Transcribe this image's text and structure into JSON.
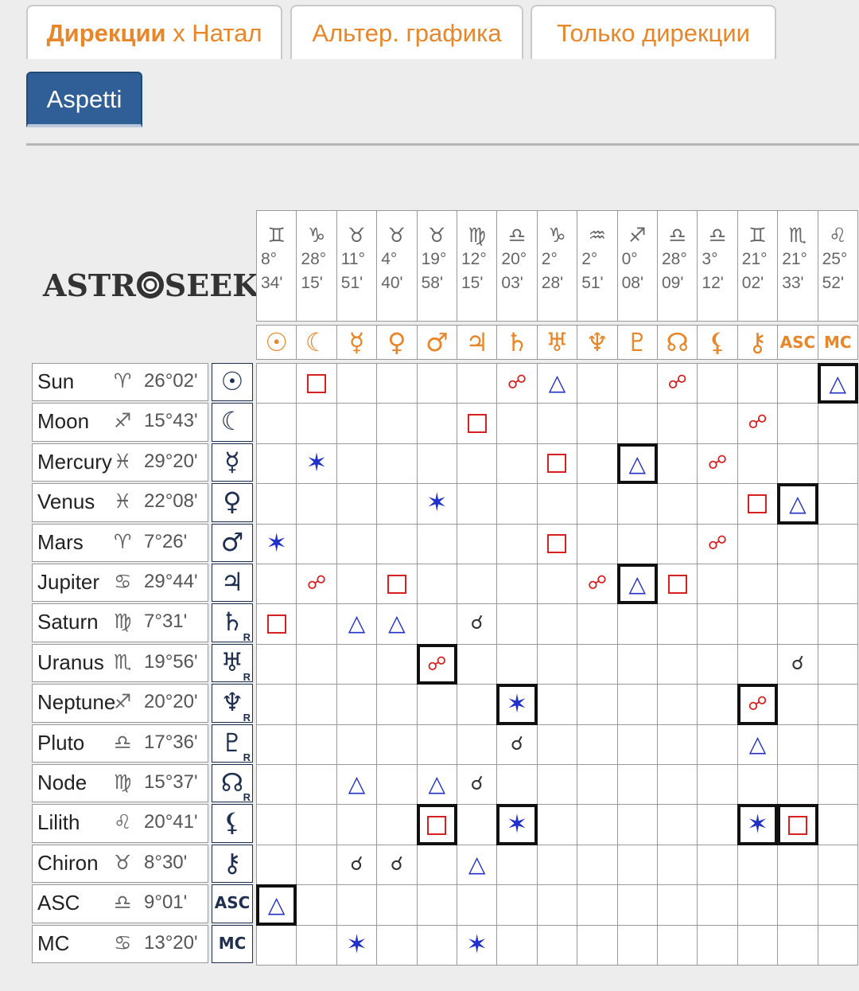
{
  "tabs": [
    {
      "label_bold": "Дирекции",
      "label_rest": " x Натал",
      "active": true
    },
    {
      "label": "Альтер. графика"
    },
    {
      "label": "Только дирекции"
    }
  ],
  "subtab": {
    "label": "Aspetti"
  },
  "logo": {
    "left": "ASTR",
    "right": "SEEK"
  },
  "columns": [
    {
      "sign": "♊",
      "deg": "8°",
      "min": "34'",
      "planet": "☉"
    },
    {
      "sign": "♑",
      "deg": "28°",
      "min": "15'",
      "planet": "☾"
    },
    {
      "sign": "♉",
      "deg": "11°",
      "min": "51'",
      "planet": "☿"
    },
    {
      "sign": "♉",
      "deg": "4°",
      "min": "40'",
      "planet": "♀"
    },
    {
      "sign": "♉",
      "deg": "19°",
      "min": "58'",
      "planet": "♂"
    },
    {
      "sign": "♍",
      "deg": "12°",
      "min": "15'",
      "planet": "♃"
    },
    {
      "sign": "♎",
      "deg": "20°",
      "min": "03'",
      "planet": "♄"
    },
    {
      "sign": "♑",
      "deg": "2°",
      "min": "28'",
      "planet": "♅"
    },
    {
      "sign": "♒",
      "deg": "2°",
      "min": "51'",
      "planet": "♆"
    },
    {
      "sign": "♐",
      "deg": "0°",
      "min": "08'",
      "planet": "♇"
    },
    {
      "sign": "♎",
      "deg": "28°",
      "min": "09'",
      "planet": "☊"
    },
    {
      "sign": "♎",
      "deg": "3°",
      "min": "12'",
      "planet": "⚸"
    },
    {
      "sign": "♊",
      "deg": "21°",
      "min": "02'",
      "planet": "⚷"
    },
    {
      "sign": "♏",
      "deg": "21°",
      "min": "33'",
      "planet": "ASC"
    },
    {
      "sign": "♌",
      "deg": "25°",
      "min": "52'",
      "planet": "MC"
    }
  ],
  "rows": [
    {
      "name": "Sun",
      "sign": "♈",
      "pos": "26°02'",
      "glyph": "☉",
      "retro": ""
    },
    {
      "name": "Moon",
      "sign": "♐",
      "pos": "15°43'",
      "glyph": "☾",
      "retro": ""
    },
    {
      "name": "Mercury",
      "sign": "♓",
      "pos": "29°20'",
      "glyph": "☿",
      "retro": ""
    },
    {
      "name": "Venus",
      "sign": "♓",
      "pos": "22°08'",
      "glyph": "♀",
      "retro": ""
    },
    {
      "name": "Mars",
      "sign": "♈",
      "pos": "7°26'",
      "glyph": "♂",
      "retro": ""
    },
    {
      "name": "Jupiter",
      "sign": "♋",
      "pos": "29°44'",
      "glyph": "♃",
      "retro": ""
    },
    {
      "name": "Saturn",
      "sign": "♍",
      "pos": "7°31'",
      "glyph": "♄",
      "retro": "R"
    },
    {
      "name": "Uranus",
      "sign": "♏",
      "pos": "19°56'",
      "glyph": "♅",
      "retro": "R"
    },
    {
      "name": "Neptune",
      "sign": "♐",
      "pos": "20°20'",
      "glyph": "♆",
      "retro": "R"
    },
    {
      "name": "Pluto",
      "sign": "♎",
      "pos": "17°36'",
      "glyph": "♇",
      "retro": "R"
    },
    {
      "name": "Node",
      "sign": "♍",
      "pos": "15°37'",
      "glyph": "☊",
      "retro": "R"
    },
    {
      "name": "Lilith",
      "sign": "♌",
      "pos": "20°41'",
      "glyph": "⚸",
      "retro": ""
    },
    {
      "name": "Chiron",
      "sign": "♉",
      "pos": "8°30'",
      "glyph": "⚷",
      "retro": ""
    },
    {
      "name": "ASC",
      "sign": "♎",
      "pos": "9°01'",
      "glyph": "ASC",
      "retro": ""
    },
    {
      "name": "MC",
      "sign": "♋",
      "pos": "13°20'",
      "glyph": "MC",
      "retro": ""
    }
  ],
  "aspects": [
    {
      "r": 0,
      "c": 1,
      "t": "square"
    },
    {
      "r": 0,
      "c": 6,
      "t": "opposition"
    },
    {
      "r": 0,
      "c": 7,
      "t": "trine"
    },
    {
      "r": 0,
      "c": 10,
      "t": "opposition"
    },
    {
      "r": 0,
      "c": 14,
      "t": "trine",
      "hl": true
    },
    {
      "r": 1,
      "c": 5,
      "t": "square"
    },
    {
      "r": 1,
      "c": 12,
      "t": "opposition"
    },
    {
      "r": 2,
      "c": 1,
      "t": "sextile"
    },
    {
      "r": 2,
      "c": 7,
      "t": "square"
    },
    {
      "r": 2,
      "c": 9,
      "t": "trine",
      "hl": true
    },
    {
      "r": 2,
      "c": 11,
      "t": "opposition"
    },
    {
      "r": 3,
      "c": 4,
      "t": "sextile"
    },
    {
      "r": 3,
      "c": 12,
      "t": "square"
    },
    {
      "r": 3,
      "c": 13,
      "t": "trine",
      "hl": true
    },
    {
      "r": 4,
      "c": 0,
      "t": "sextile"
    },
    {
      "r": 4,
      "c": 7,
      "t": "square"
    },
    {
      "r": 4,
      "c": 11,
      "t": "opposition"
    },
    {
      "r": 5,
      "c": 1,
      "t": "opposition"
    },
    {
      "r": 5,
      "c": 3,
      "t": "square"
    },
    {
      "r": 5,
      "c": 8,
      "t": "opposition"
    },
    {
      "r": 5,
      "c": 9,
      "t": "trine",
      "hl": true
    },
    {
      "r": 5,
      "c": 10,
      "t": "square"
    },
    {
      "r": 6,
      "c": 0,
      "t": "square"
    },
    {
      "r": 6,
      "c": 2,
      "t": "trine"
    },
    {
      "r": 6,
      "c": 3,
      "t": "trine"
    },
    {
      "r": 6,
      "c": 5,
      "t": "conjunction"
    },
    {
      "r": 7,
      "c": 4,
      "t": "opposition",
      "hl": true
    },
    {
      "r": 7,
      "c": 13,
      "t": "conjunction"
    },
    {
      "r": 8,
      "c": 6,
      "t": "sextile",
      "hl": true
    },
    {
      "r": 8,
      "c": 12,
      "t": "opposition",
      "hl": true
    },
    {
      "r": 9,
      "c": 6,
      "t": "conjunction"
    },
    {
      "r": 9,
      "c": 12,
      "t": "trine"
    },
    {
      "r": 10,
      "c": 2,
      "t": "trine"
    },
    {
      "r": 10,
      "c": 4,
      "t": "trine"
    },
    {
      "r": 10,
      "c": 5,
      "t": "conjunction"
    },
    {
      "r": 11,
      "c": 4,
      "t": "square",
      "hl": true
    },
    {
      "r": 11,
      "c": 6,
      "t": "sextile",
      "hl": true
    },
    {
      "r": 11,
      "c": 12,
      "t": "sextile",
      "hl": true
    },
    {
      "r": 11,
      "c": 13,
      "t": "square",
      "hl": true
    },
    {
      "r": 12,
      "c": 2,
      "t": "conjunction"
    },
    {
      "r": 12,
      "c": 3,
      "t": "conjunction"
    },
    {
      "r": 12,
      "c": 5,
      "t": "trine"
    },
    {
      "r": 13,
      "c": 0,
      "t": "trine",
      "hl": true
    },
    {
      "r": 14,
      "c": 2,
      "t": "sextile"
    },
    {
      "r": 14,
      "c": 5,
      "t": "sextile"
    }
  ],
  "aspect_symbols": {
    "square": "",
    "trine": "△",
    "sextile": "✶",
    "opposition": "☍",
    "conjunction": "☌"
  },
  "colors": {
    "tab_text": "#e8862a",
    "subtab_bg": "#2f5f96",
    "square": "#d92020",
    "trine": "#2030c8",
    "planet_header": "#e8862a",
    "row_glyph": "#1e2f50"
  }
}
